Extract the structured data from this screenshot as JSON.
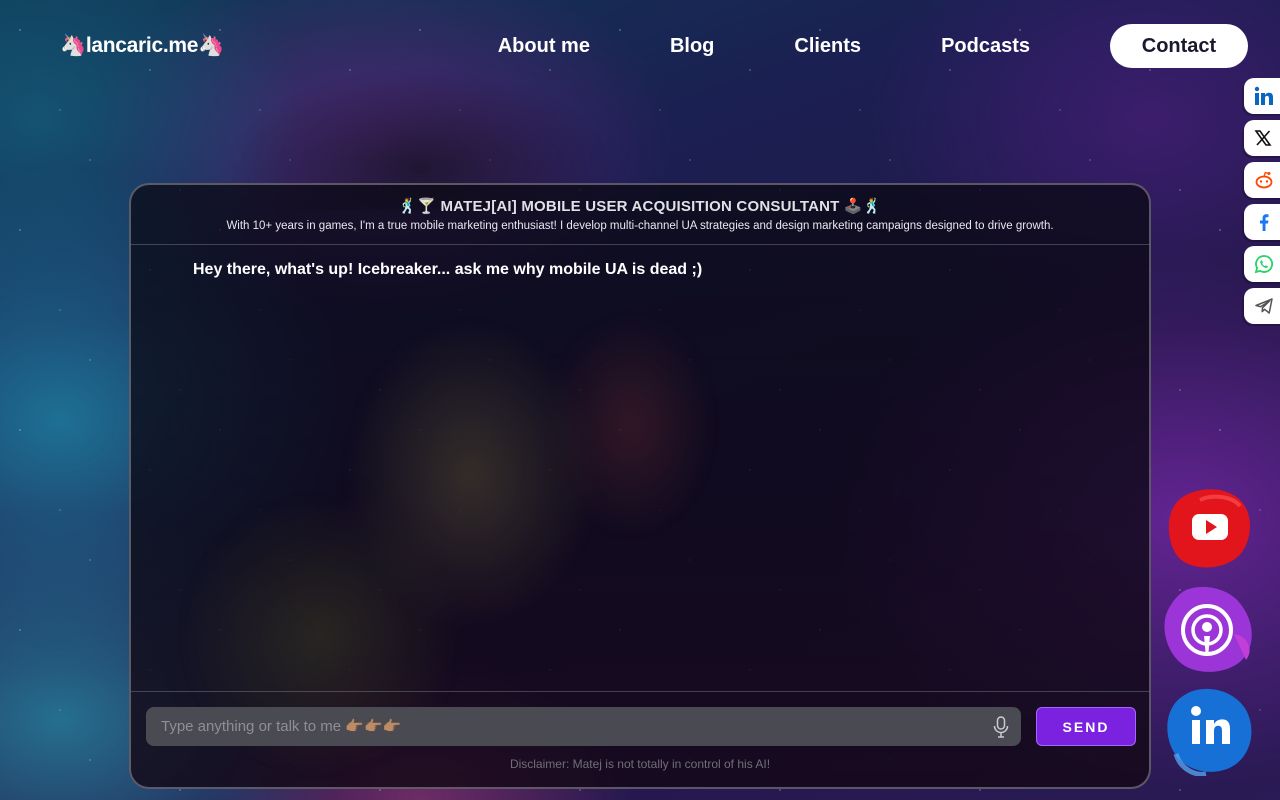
{
  "header": {
    "logo": "🦄lancaric.me🦄",
    "nav": [
      {
        "label": "About me"
      },
      {
        "label": "Blog"
      },
      {
        "label": "Clients"
      },
      {
        "label": "Podcasts"
      }
    ],
    "contact_label": "Contact"
  },
  "share_rail": {
    "items": [
      {
        "icon": "linkedin-icon",
        "color": "#0a66c2"
      },
      {
        "icon": "x-icon",
        "color": "#000000"
      },
      {
        "icon": "reddit-icon",
        "color": "#ff4500"
      },
      {
        "icon": "facebook-icon",
        "color": "#1877f2"
      },
      {
        "icon": "whatsapp-icon",
        "color": "#25d366"
      },
      {
        "icon": "telegram-icon",
        "color": "#555555"
      }
    ]
  },
  "chat": {
    "title": "🕺🍸 MATEJ[AI] MOBILE USER ACQUISITION CONSULTANT 🕹️🕺",
    "subtitle": "With 10+ years in games, I'm a true mobile marketing enthusiast! I develop multi-channel UA strategies and design marketing campaigns designed to drive growth.",
    "message": "Hey there, what's up! Icebreaker... ask me why mobile UA is dead ;)",
    "input_placeholder": "Type anything or talk to me 👉🏽👉🏽👉🏽",
    "input_value": "",
    "send_label": "SEND",
    "disclaimer": "Disclaimer: Matej is not totally in control of his AI!"
  },
  "social_blobs": [
    {
      "icon": "youtube-icon",
      "color": "#e2141c"
    },
    {
      "icon": "podcast-icon",
      "color": "#9b35d8"
    },
    {
      "icon": "linkedin-icon",
      "color": "#1670d6"
    }
  ],
  "colors": {
    "accent": "#7a22e0",
    "input_bg": "#4a4a52"
  }
}
